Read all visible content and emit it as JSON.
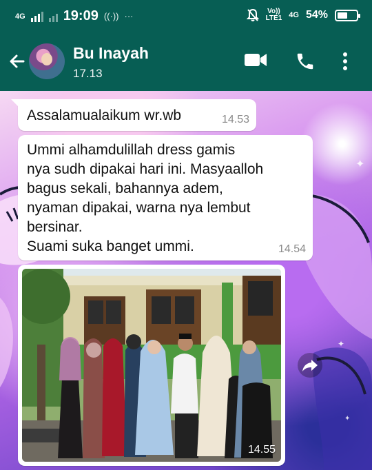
{
  "status_bar": {
    "network_left": "4G",
    "time": "19:09",
    "volte_top": "Vo))",
    "volte_bottom": "LTE1",
    "network_right": "4G",
    "battery_percent": "54%",
    "battery_level": 0.54,
    "icons": [
      "signal-icon",
      "hotspot-icon",
      "more-dots-icon",
      "mute-bell-icon",
      "battery-icon"
    ]
  },
  "header": {
    "contact_name": "Bu Inayah",
    "last_seen": "17.13",
    "icons": [
      "back-arrow-icon",
      "video-call-icon",
      "phone-call-icon",
      "overflow-menu-icon"
    ],
    "colors": {
      "bar": "#075e54"
    }
  },
  "messages": [
    {
      "type": "text",
      "text": "Assalamualaikum wr.wb",
      "time": "14.53"
    },
    {
      "type": "text",
      "text": "Ummi alhamdulillah dress gamis\nnya sudh dipakai hari ini. Masyaalloh\nbagus sekali, bahannya adem,\nnyaman dipakai, warna nya lembut\nbersinar.\nSuami suka banget ummi.",
      "time": "14.54"
    },
    {
      "type": "image",
      "time": "14.55"
    }
  ]
}
